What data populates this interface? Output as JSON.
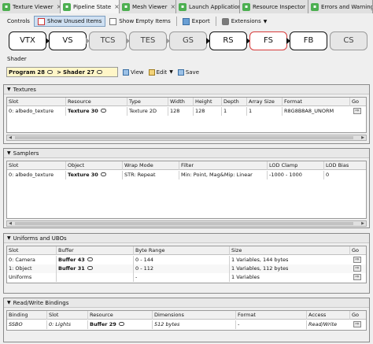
{
  "dock_tabs": [
    {
      "label": "Texture Viewer"
    },
    {
      "label": "Pipeline State"
    },
    {
      "label": "Mesh Viewer"
    },
    {
      "label": "Launch Application"
    },
    {
      "label": "Resource Inspector"
    },
    {
      "label": "Errors and Warnings"
    }
  ],
  "toolbar": {
    "controls": "Controls",
    "show_unused": "Show Unused Items",
    "show_empty": "Show Empty Items",
    "export": "Export",
    "extensions": "Extensions"
  },
  "pipeline": {
    "stages": [
      "VTX",
      "VS",
      "TCS",
      "TES",
      "GS",
      "RS",
      "FS",
      "FB",
      "CS"
    ]
  },
  "shader": {
    "label": "Shader",
    "program": "Program 28",
    "shader": "Shader 27",
    "separator": ">",
    "view": "View",
    "edit": "Edit",
    "save": "Save"
  },
  "textures": {
    "title": "Textures",
    "headers": [
      "Slot",
      "Resource",
      "Type",
      "Width",
      "Height",
      "Depth",
      "Array Size",
      "Format",
      "Go"
    ],
    "rows": [
      [
        "0: albedo_texture",
        "Texture 30",
        "Texture 2D",
        "128",
        "128",
        "1",
        "1",
        "R8G8B8A8_UNORM"
      ]
    ]
  },
  "samplers": {
    "title": "Samplers",
    "headers": [
      "Slot",
      "Object",
      "Wrap Mode",
      "Filter",
      "LOD Clamp",
      "LOD Bias"
    ],
    "rows": [
      [
        "0: albedo_texture",
        "Texture 30",
        "STR: Repeat",
        "Min: Point, Mag&Mip: Linear",
        "-1000 - 1000",
        "0"
      ]
    ]
  },
  "ubos": {
    "title": "Uniforms and UBOs",
    "headers": [
      "Slot",
      "Buffer",
      "Byte Range",
      "Size",
      "Go"
    ],
    "rows": [
      [
        "0: Camera",
        "Buffer 43",
        "0 - 144",
        "1 Variables, 144 bytes"
      ],
      [
        "1: Object",
        "Buffer 31",
        "0 - 112",
        "1 Variables, 112 bytes"
      ],
      [
        "Uniforms",
        "",
        "-",
        "1 Variables"
      ]
    ]
  },
  "rw": {
    "title": "Read/Write Bindings",
    "headers": [
      "Binding",
      "Slot",
      "Resource",
      "Dimensions",
      "Format",
      "Access",
      "Go"
    ],
    "rows": [
      [
        "SSBO",
        "0: Lights",
        "Buffer 29",
        "512 bytes",
        "-",
        "Read/Write"
      ]
    ]
  }
}
